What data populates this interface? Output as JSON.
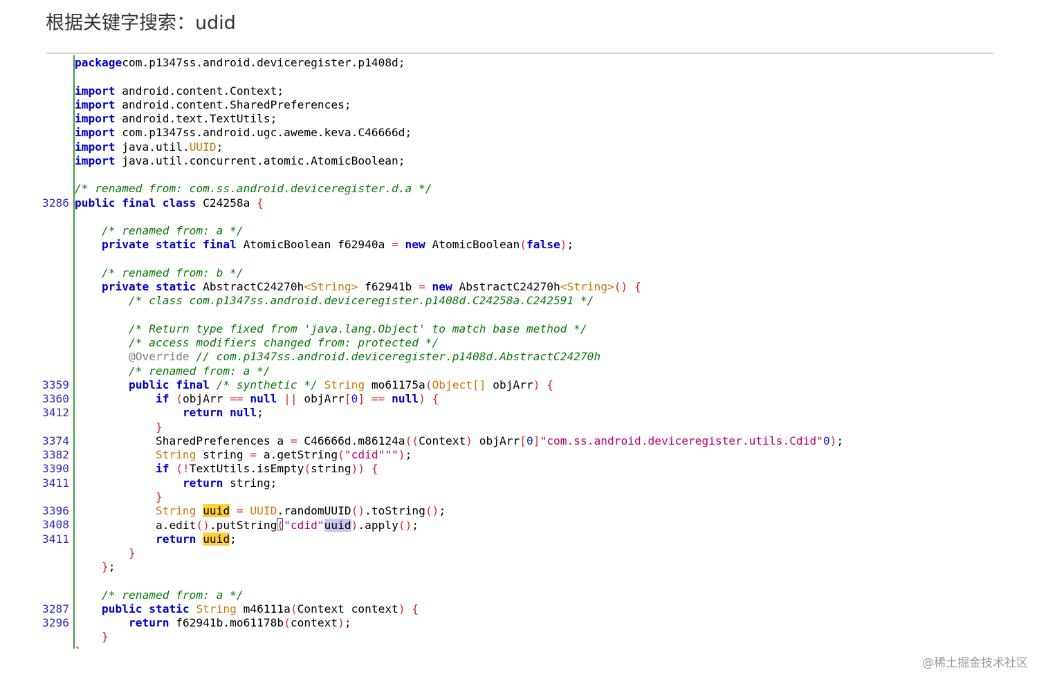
{
  "header": {
    "title": "根据关键字搜索：udid"
  },
  "code": {
    "lines": [
      {
        "ln": "",
        "tokens": [
          [
            "kw",
            "package"
          ],
          [
            "",
            "com.p1347ss.android.deviceregister.p1408d;"
          ]
        ]
      },
      {
        "ln": "",
        "tokens": []
      },
      {
        "ln": "",
        "tokens": [
          [
            "kw",
            "import"
          ],
          [
            "",
            " android.content.Context;"
          ]
        ]
      },
      {
        "ln": "",
        "tokens": [
          [
            "kw",
            "import"
          ],
          [
            "",
            " android.content.SharedPreferences;"
          ]
        ]
      },
      {
        "ln": "",
        "tokens": [
          [
            "kw",
            "import"
          ],
          [
            "",
            " android.text.TextUtils;"
          ]
        ]
      },
      {
        "ln": "",
        "tokens": [
          [
            "kw",
            "import"
          ],
          [
            "",
            " com.p1347ss.android.ugc.aweme.keva.C46666d;"
          ]
        ]
      },
      {
        "ln": "",
        "tokens": [
          [
            "kw",
            "import"
          ],
          [
            "",
            " java.util."
          ],
          [
            "ty",
            "UUID"
          ],
          [
            "",
            ";"
          ]
        ]
      },
      {
        "ln": "",
        "tokens": [
          [
            "kw",
            "import"
          ],
          [
            "",
            " java.util.concurrent.atomic.AtomicBoolean;"
          ]
        ]
      },
      {
        "ln": "",
        "tokens": []
      },
      {
        "ln": "",
        "tokens": [
          [
            "cm",
            "/* renamed from: com.ss.android.deviceregister.d.a */"
          ]
        ]
      },
      {
        "ln": "3286",
        "tokens": [
          [
            "kw",
            "public final class"
          ],
          [
            "",
            " C24258a "
          ],
          [
            "pu",
            "{"
          ]
        ]
      },
      {
        "ln": "",
        "tokens": []
      },
      {
        "ln": "",
        "tokens": [
          [
            "",
            "    "
          ],
          [
            "cm",
            "/* renamed from: a */"
          ]
        ]
      },
      {
        "ln": "",
        "tokens": [
          [
            "",
            "    "
          ],
          [
            "kw",
            "private static final"
          ],
          [
            "",
            " AtomicBoolean f62940a "
          ],
          [
            "pu",
            "="
          ],
          [
            "",
            ""
          ],
          [
            "kw",
            " new"
          ],
          [
            "",
            " AtomicBoolean"
          ],
          [
            "pu",
            "("
          ],
          [
            "kw",
            "false"
          ],
          [
            "pu",
            ")"
          ],
          [
            "",
            ";"
          ]
        ]
      },
      {
        "ln": "",
        "tokens": []
      },
      {
        "ln": "",
        "tokens": [
          [
            "",
            "    "
          ],
          [
            "cm",
            "/* renamed from: b */"
          ]
        ]
      },
      {
        "ln": "",
        "tokens": [
          [
            "",
            "    "
          ],
          [
            "kw",
            "private static"
          ],
          [
            "",
            " AbstractC24270h"
          ],
          [
            "ty",
            "<String>"
          ],
          [
            "",
            " f62941b "
          ],
          [
            "pu",
            "="
          ],
          [
            "kw",
            " new"
          ],
          [
            "",
            " AbstractC24270h"
          ],
          [
            "ty",
            "<String>"
          ],
          [
            "pu",
            "()"
          ],
          [
            "",
            " "
          ],
          [
            "pu",
            "{"
          ]
        ]
      },
      {
        "ln": "",
        "tokens": [
          [
            "",
            "        "
          ],
          [
            "cm",
            "/* class com.p1347ss.android.deviceregister.p1408d.C24258a.C242591 */"
          ]
        ]
      },
      {
        "ln": "",
        "tokens": []
      },
      {
        "ln": "",
        "tokens": [
          [
            "",
            "        "
          ],
          [
            "cm",
            "/* Return type fixed from 'java.lang.Object' to match base method */"
          ]
        ]
      },
      {
        "ln": "",
        "tokens": [
          [
            "",
            "        "
          ],
          [
            "cm",
            "/* access modifiers changed from: protected */"
          ]
        ]
      },
      {
        "ln": "",
        "tokens": [
          [
            "",
            "        "
          ],
          [
            "an",
            "@Override"
          ],
          [
            "cm",
            " // com.p1347ss.android.deviceregister.p1408d.AbstractC24270h"
          ]
        ]
      },
      {
        "ln": "",
        "tokens": [
          [
            "",
            "        "
          ],
          [
            "cm",
            "/* renamed from: a */"
          ]
        ]
      },
      {
        "ln": "3359",
        "tokens": [
          [
            "",
            "        "
          ],
          [
            "kw",
            "public final"
          ],
          [
            "cm",
            " /* synthetic */"
          ],
          [
            "",
            " "
          ],
          [
            "ty",
            "String"
          ],
          [
            "",
            " mo61175a"
          ],
          [
            "pu",
            "("
          ],
          [
            "ty",
            "Object[]"
          ],
          [
            "",
            " objArr"
          ],
          [
            "pu",
            ")"
          ],
          [
            "",
            " "
          ],
          [
            "pu",
            "{"
          ]
        ]
      },
      {
        "ln": "3360",
        "tokens": [
          [
            "",
            "            "
          ],
          [
            "kw",
            "if"
          ],
          [
            "",
            " "
          ],
          [
            "pu",
            "("
          ],
          [
            "",
            "objArr "
          ],
          [
            "pu",
            "=="
          ],
          [
            "kw",
            " null"
          ],
          [
            "",
            " "
          ],
          [
            "pu",
            "||"
          ],
          [
            "",
            " objArr"
          ],
          [
            "pu",
            "["
          ],
          [
            "nm",
            "0"
          ],
          [
            "pu",
            "]"
          ],
          [
            "",
            " "
          ],
          [
            "pu",
            "=="
          ],
          [
            "kw",
            " null"
          ],
          [
            "pu",
            ")"
          ],
          [
            "",
            " "
          ],
          [
            "pu",
            "{"
          ]
        ]
      },
      {
        "ln": "3412",
        "tokens": [
          [
            "",
            "                "
          ],
          [
            "kw",
            "return null"
          ],
          [
            "",
            ";"
          ]
        ]
      },
      {
        "ln": "",
        "tokens": [
          [
            "",
            "            "
          ],
          [
            "pu",
            "}"
          ]
        ]
      },
      {
        "ln": "3374",
        "tokens": [
          [
            "",
            "            SharedPreferences a "
          ],
          [
            "pu",
            "="
          ],
          [
            "",
            " C46666d.m86124a"
          ],
          [
            "pu",
            "(("
          ],
          [
            "",
            "Context"
          ],
          [
            "pu",
            ")"
          ],
          [
            "",
            " objArr"
          ],
          [
            "pu",
            "["
          ],
          [
            "nm",
            "0"
          ],
          [
            "pu",
            "]"
          ],
          [
            ", "
          ],
          [
            "st",
            "\"com.ss.android.deviceregister.utils.Cdid\""
          ],
          [
            ", "
          ],
          [
            "nm",
            "0"
          ],
          [
            "pu",
            ")"
          ],
          [
            "",
            ";"
          ]
        ]
      },
      {
        "ln": "3382",
        "tokens": [
          [
            "",
            "            "
          ],
          [
            "ty",
            "String"
          ],
          [
            "",
            " string "
          ],
          [
            "pu",
            "="
          ],
          [
            "",
            " a.getString"
          ],
          [
            "pu",
            "("
          ],
          [
            "st",
            "\"cdid\""
          ],
          [
            ", "
          ],
          [
            "st",
            "\"\""
          ],
          [
            "pu",
            ")"
          ],
          [
            "",
            ";"
          ]
        ]
      },
      {
        "ln": "3390",
        "tokens": [
          [
            "",
            "            "
          ],
          [
            "kw",
            "if"
          ],
          [
            "",
            " "
          ],
          [
            "pu",
            "(!"
          ],
          [
            "",
            "TextUtils.isEmpty"
          ],
          [
            "pu",
            "("
          ],
          [
            "",
            "string"
          ],
          [
            "pu",
            "))"
          ],
          [
            "",
            " "
          ],
          [
            "pu",
            "{"
          ]
        ]
      },
      {
        "ln": "3411",
        "tokens": [
          [
            "",
            "                "
          ],
          [
            "kw",
            "return"
          ],
          [
            "",
            " string;"
          ]
        ]
      },
      {
        "ln": "",
        "tokens": [
          [
            "",
            "            "
          ],
          [
            "pu",
            "}"
          ]
        ]
      },
      {
        "ln": "3396",
        "tokens": [
          [
            "",
            "            "
          ],
          [
            "ty",
            "String"
          ],
          [
            "",
            " "
          ],
          [
            "hl",
            "uuid"
          ],
          [
            "",
            " "
          ],
          [
            "pu",
            "="
          ],
          [
            "",
            " "
          ],
          [
            "ty",
            "UUID"
          ],
          [
            "",
            ".randomUUID"
          ],
          [
            "pu",
            "()"
          ],
          [
            "",
            ".toString"
          ],
          [
            "pu",
            "()"
          ],
          [
            "",
            ";"
          ]
        ]
      },
      {
        "ln": "3408",
        "tokens": [
          [
            "",
            "            a.edit"
          ],
          [
            "pu",
            "()"
          ],
          [
            "",
            ".putString"
          ],
          [
            "cur",
            ""
          ],
          [
            "pu",
            "("
          ],
          [
            "st",
            "\"cdid\""
          ],
          [
            ", "
          ],
          [
            "hl2",
            "uuid"
          ],
          [
            "pu",
            ")"
          ],
          [
            "",
            ".apply"
          ],
          [
            "pu",
            "()"
          ],
          [
            "",
            ";"
          ]
        ]
      },
      {
        "ln": "3411",
        "tokens": [
          [
            "",
            "            "
          ],
          [
            "kw",
            "return"
          ],
          [
            "",
            " "
          ],
          [
            "hl",
            "uuid"
          ],
          [
            "",
            ";"
          ]
        ]
      },
      {
        "ln": "",
        "tokens": [
          [
            "",
            "        "
          ],
          [
            "pu",
            "}"
          ]
        ]
      },
      {
        "ln": "",
        "tokens": [
          [
            "",
            "    "
          ],
          [
            "pu",
            "}"
          ],
          [
            "",
            ";"
          ]
        ]
      },
      {
        "ln": "",
        "tokens": []
      },
      {
        "ln": "",
        "tokens": [
          [
            "",
            "    "
          ],
          [
            "cm",
            "/* renamed from: a */"
          ]
        ]
      },
      {
        "ln": "3287",
        "tokens": [
          [
            "",
            "    "
          ],
          [
            "kw",
            "public static"
          ],
          [
            "",
            " "
          ],
          [
            "ty",
            "String"
          ],
          [
            "",
            " m46111a"
          ],
          [
            "pu",
            "("
          ],
          [
            "",
            "Context context"
          ],
          [
            "pu",
            ")"
          ],
          [
            "",
            " "
          ],
          [
            "pu",
            "{"
          ]
        ]
      },
      {
        "ln": "3296",
        "tokens": [
          [
            "",
            "        "
          ],
          [
            "kw",
            "return"
          ],
          [
            "",
            " f62941b.mo61178b"
          ],
          [
            "pu",
            "("
          ],
          [
            "",
            "context"
          ],
          [
            "pu",
            ")"
          ],
          [
            "",
            ";"
          ]
        ]
      },
      {
        "ln": "",
        "tokens": [
          [
            "",
            "    "
          ],
          [
            "pu",
            "}"
          ]
        ]
      },
      {
        "ln": "",
        "tokens": [
          [
            "pu",
            "}"
          ]
        ]
      }
    ]
  },
  "watermark": {
    "text": "@稀土掘金技术社区"
  }
}
